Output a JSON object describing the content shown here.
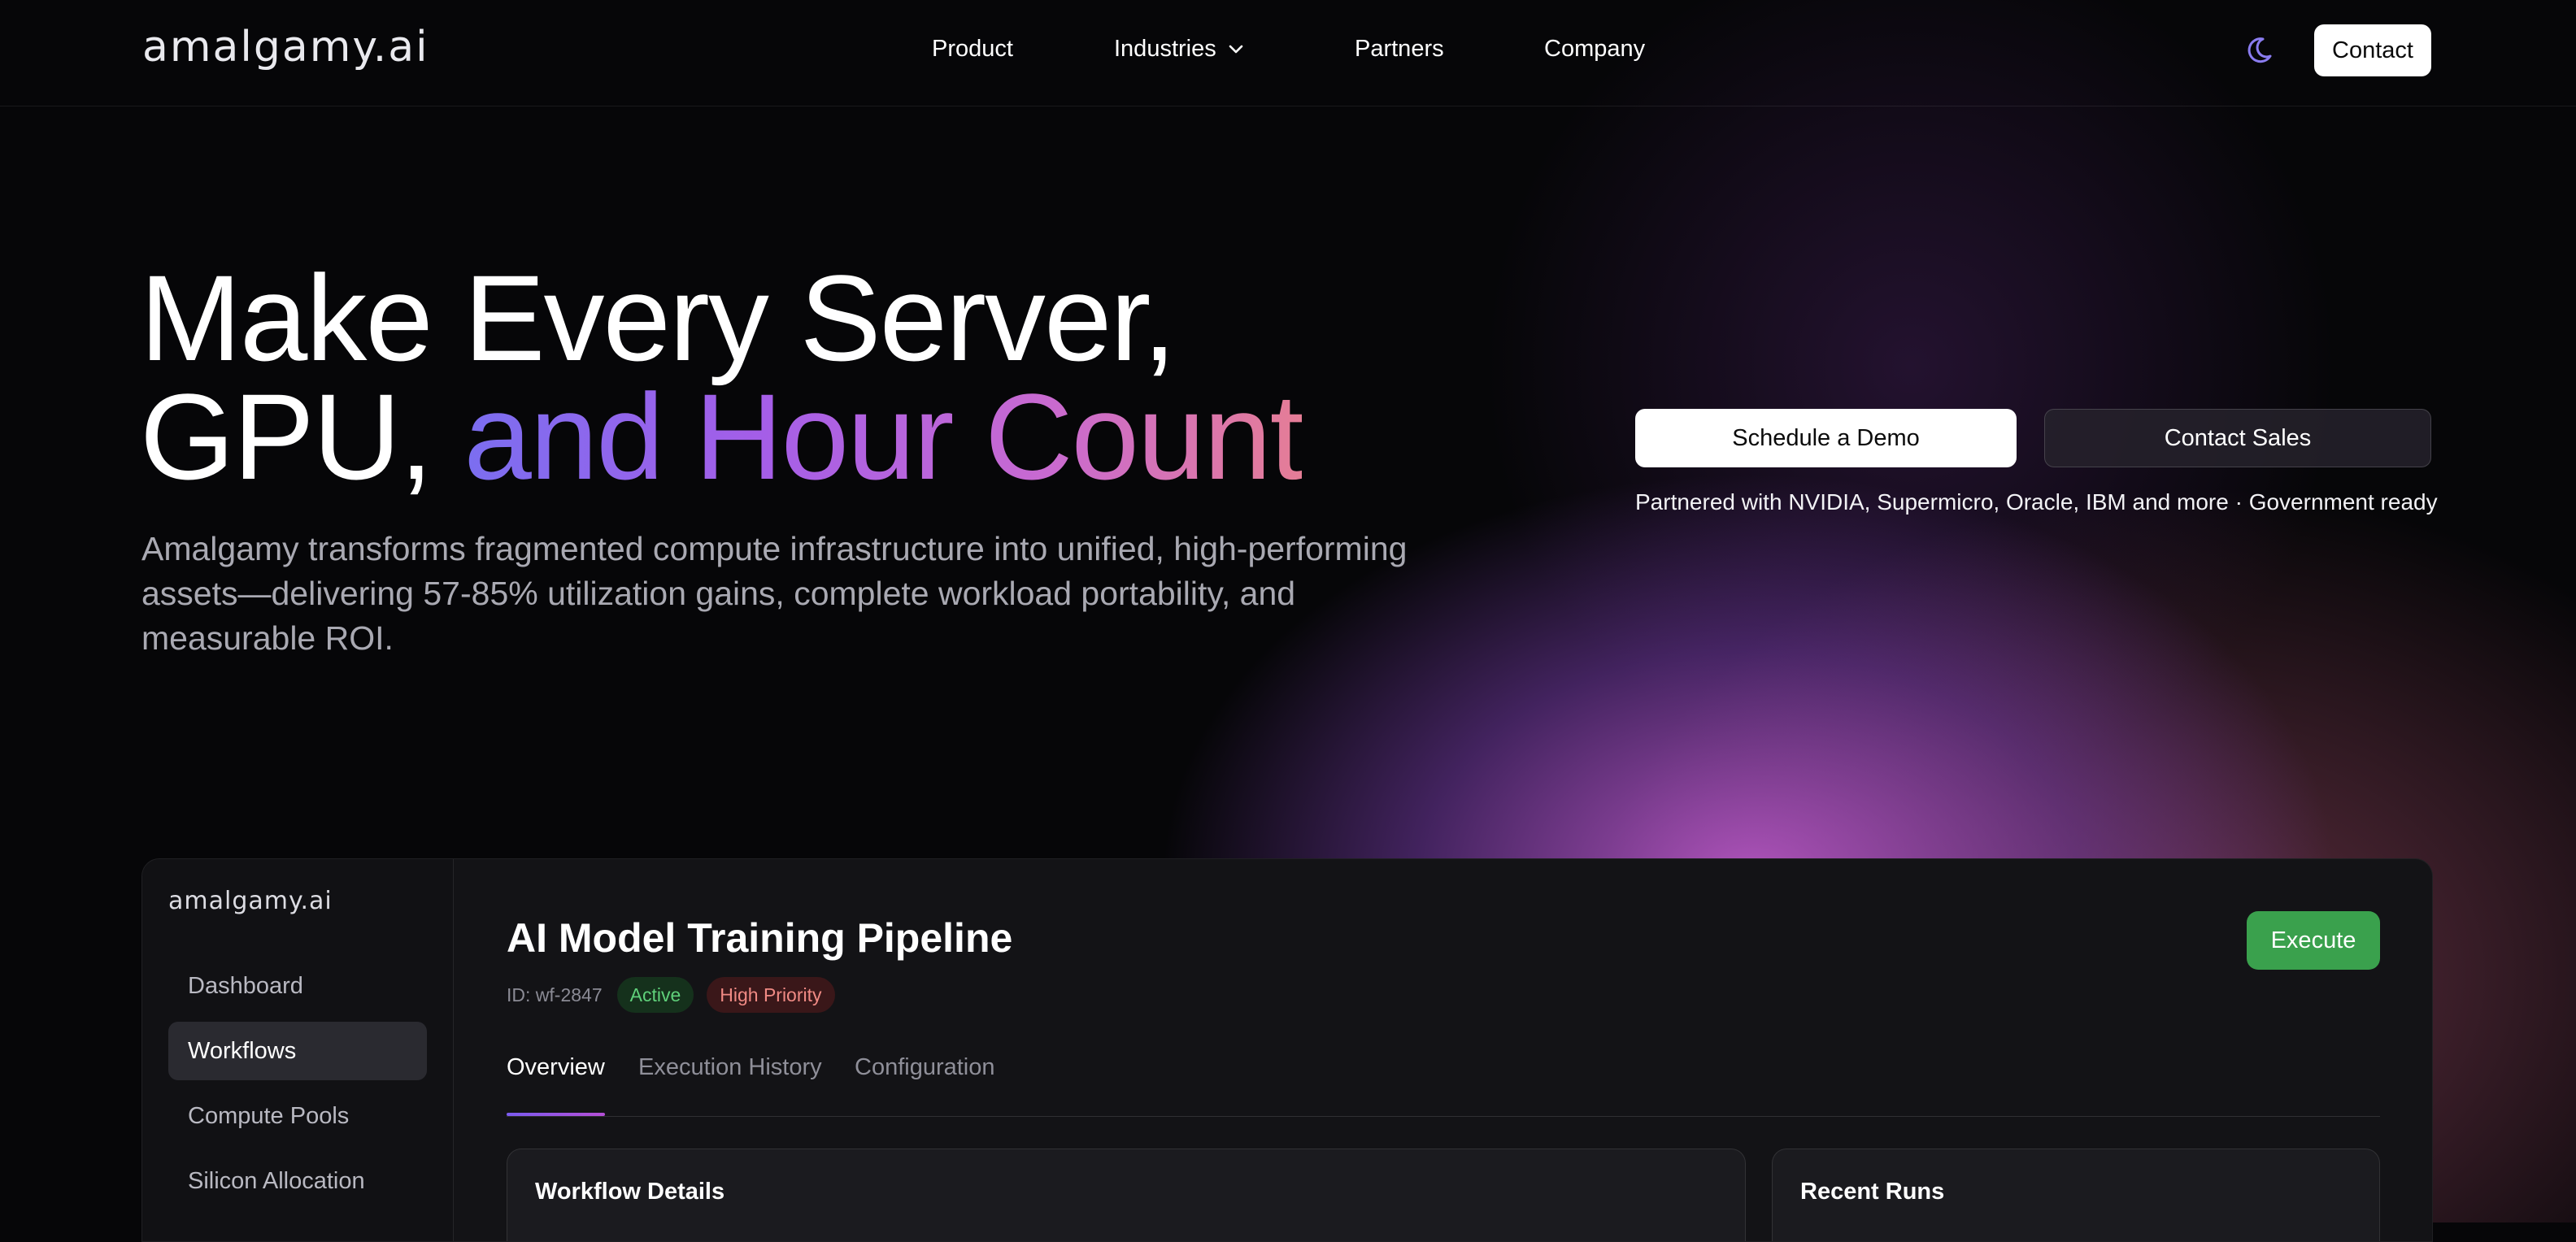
{
  "header": {
    "logo": "amalgamy.ai",
    "nav": [
      {
        "label": "Product"
      },
      {
        "label": "Industries"
      },
      {
        "label": "Partners"
      },
      {
        "label": "Company"
      }
    ],
    "contact_label": "Contact"
  },
  "hero": {
    "title_line1": "Make Every Server,",
    "title_line2_plain": "GPU, ",
    "title_line2_gradient": "and Hour Count",
    "subtitle": "Amalgamy transforms fragmented compute infrastructure into unified, high-performing assets—delivering 57-85% utilization gains, complete workload portability, and measurable ROI.",
    "cta_primary": "Schedule a Demo",
    "cta_secondary": "Contact Sales",
    "partners_note": "Partnered with NVIDIA, Supermicro, Oracle, IBM and more · Government ready"
  },
  "dashboard": {
    "logo": "amalgamy.ai",
    "sidebar": [
      {
        "label": "Dashboard",
        "active": false
      },
      {
        "label": "Workflows",
        "active": true
      },
      {
        "label": "Compute Pools",
        "active": false
      },
      {
        "label": "Silicon Allocation",
        "active": false
      }
    ],
    "workflow": {
      "title": "AI Model Training Pipeline",
      "id": "ID: wf-2847",
      "status": "Active",
      "priority": "High Priority",
      "execute_label": "Execute"
    },
    "tabs": [
      {
        "label": "Overview",
        "active": true
      },
      {
        "label": "Execution History",
        "active": false
      },
      {
        "label": "Configuration",
        "active": false
      }
    ],
    "panels": {
      "details_title": "Workflow Details",
      "runs_title": "Recent Runs"
    }
  },
  "colors": {
    "accent_gradient": [
      "#7b6ef0",
      "#a45ee8",
      "#c96ad0",
      "#e57d96"
    ],
    "execute_green": "#3aa14d",
    "active_badge": "#5fd07a",
    "priority_badge": "#f08a84"
  },
  "icons": {
    "theme_toggle": "moon-icon",
    "industries_dropdown": "chevron-down-icon"
  }
}
